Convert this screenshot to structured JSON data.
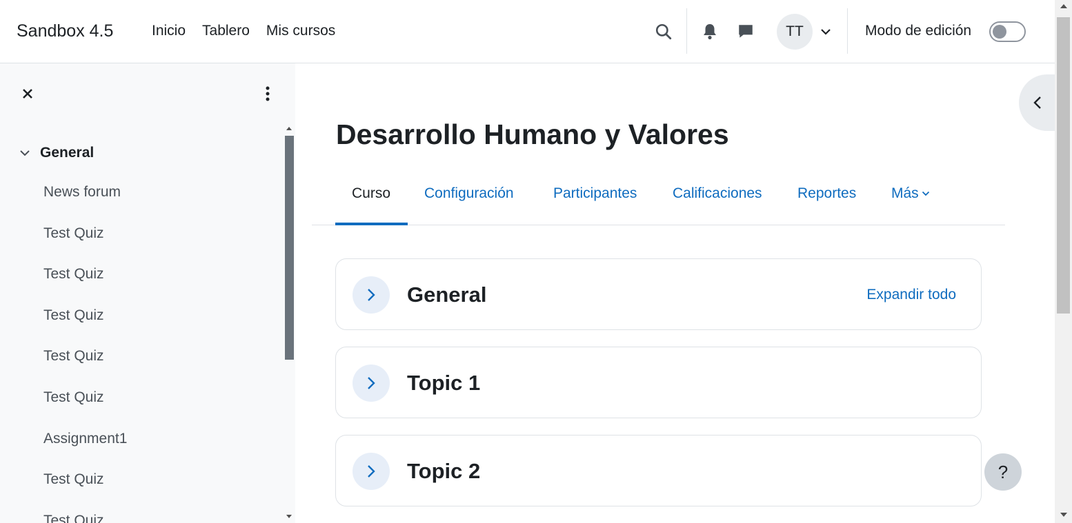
{
  "navbar": {
    "brand": "Sandbox 4.5",
    "links": [
      "Inicio",
      "Tablero",
      "Mis cursos"
    ],
    "avatar_initials": "TT",
    "edit_mode_label": "Modo de edición",
    "edit_mode_on": false
  },
  "drawer": {
    "section": "General",
    "items": [
      "News forum",
      "Test Quiz",
      "Test Quiz",
      "Test Quiz",
      "Test Quiz",
      "Test Quiz",
      "Assignment1",
      "Test Quiz",
      "Test Quiz"
    ]
  },
  "main": {
    "title": "Desarrollo Humano y Valores",
    "tabs": [
      "Curso",
      "Configuración",
      "Participantes",
      "Calificaciones",
      "Reportes",
      "Más"
    ],
    "active_tab": "Curso",
    "expand_all": "Expandir todo",
    "sections": [
      "General",
      "Topic 1",
      "Topic 2"
    ]
  },
  "help_label": "?",
  "colors": {
    "accent": "#0f6cbf",
    "drawer_bg": "#f8f9fa",
    "text": "#1d2125"
  }
}
